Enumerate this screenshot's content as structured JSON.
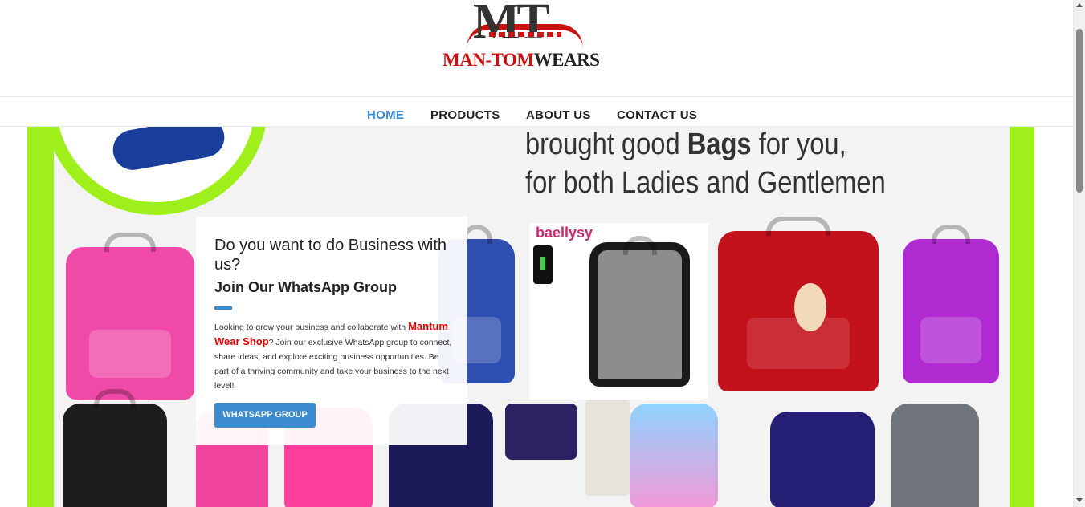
{
  "logo": {
    "monogram": "MT",
    "brand_red": "MAN-TOM",
    "brand_dark": "WEARS"
  },
  "nav": {
    "items": [
      "HOME",
      "PRODUCTS",
      "ABOUT US",
      "CONTACT US"
    ],
    "active": "HOME"
  },
  "hero": {
    "headline_line1_pre": "brought good ",
    "headline_line1_bold": "Bags",
    "headline_line1_post": " for you,",
    "headline_line2": "for both Ladies and Gentlemen",
    "product_brand": "baellysy"
  },
  "card": {
    "heading": "Do you want to do Business with us?",
    "subheading": "Join Our WhatsApp Group",
    "text_pre": "Looking to grow your business and collaborate with ",
    "text_brand": "Mantum Wear Shop",
    "text_post": "? Join our exclusive WhatsApp group to connect, share ideas, and explore exciting business opportunities. Be part of a thriving community and take your business to the next level!",
    "button_label": "WHATSAPP GROUP"
  },
  "colors": {
    "accent": "#3b8bd1",
    "brand_red": "#cc1111",
    "hero_green": "#9ff01a"
  }
}
